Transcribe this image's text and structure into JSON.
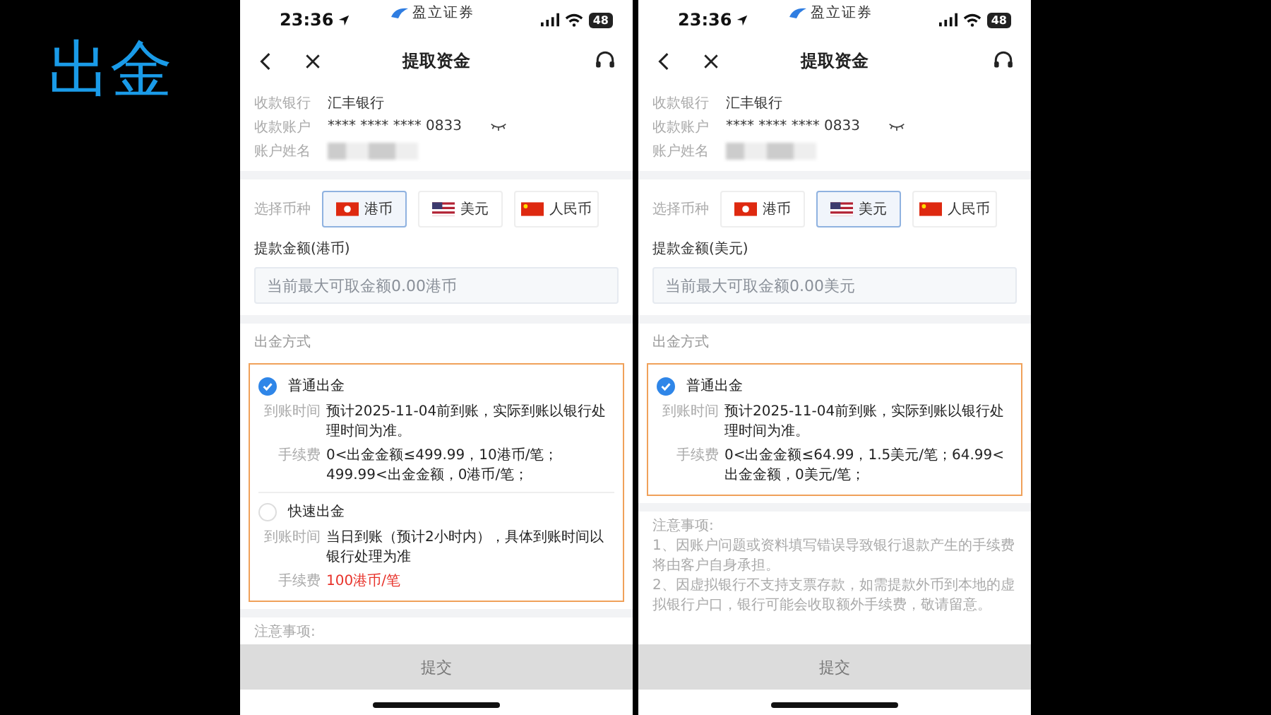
{
  "slide_title": "出金",
  "phones": [
    {
      "status": {
        "time": "23:36",
        "app_name": "盈立证券",
        "battery": "48"
      },
      "nav": {
        "title": "提取资金"
      },
      "account": {
        "rows": [
          {
            "kind": "text",
            "label": "收款银行",
            "value": "汇丰银行"
          },
          {
            "kind": "masked",
            "label": "收款账户",
            "value": "**** **** **** 0833"
          },
          {
            "kind": "blurred",
            "label": "账户姓名"
          }
        ]
      },
      "currency": {
        "label": "选择币种",
        "options": [
          {
            "kind": "hk",
            "label": "港币",
            "selected": true
          },
          {
            "kind": "us",
            "label": "美元",
            "selected": false
          },
          {
            "kind": "cn",
            "label": "人民币",
            "selected": false
          }
        ]
      },
      "amount": {
        "label": "提款金额(港币)",
        "placeholder": "当前最大可取金额0.00港币"
      },
      "methods": {
        "title": "出金方式",
        "items": [
          {
            "name": "普通出金",
            "selected": true,
            "rows": [
              {
                "label": "到账时间",
                "value": "预计2025-11-04前到账，实际到账以银行处理时间为准。",
                "alert": false
              },
              {
                "label": "手续费",
                "value": "0<出金金额≤499.99，10港币/笔；499.99<出金金额，0港币/笔；",
                "alert": false
              }
            ]
          },
          {
            "name": "快速出金",
            "selected": false,
            "rows": [
              {
                "label": "到账时间",
                "value": "当日到账（预计2小时内），具体到账时间以银行处理为准",
                "alert": false
              },
              {
                "label": "手续费",
                "value": "100港币/笔",
                "alert": true
              }
            ]
          }
        ]
      },
      "notes": {
        "title": "注意事项:"
      },
      "submit": "提交"
    },
    {
      "status": {
        "time": "23:36",
        "app_name": "盈立证券",
        "battery": "48"
      },
      "nav": {
        "title": "提取资金"
      },
      "account": {
        "rows": [
          {
            "kind": "text",
            "label": "收款银行",
            "value": "汇丰银行"
          },
          {
            "kind": "masked",
            "label": "收款账户",
            "value": "**** **** **** 0833"
          },
          {
            "kind": "blurred",
            "label": "账户姓名"
          }
        ]
      },
      "currency": {
        "label": "选择币种",
        "options": [
          {
            "kind": "hk",
            "label": "港币",
            "selected": false
          },
          {
            "kind": "us",
            "label": "美元",
            "selected": true
          },
          {
            "kind": "cn",
            "label": "人民币",
            "selected": false
          }
        ]
      },
      "amount": {
        "label": "提款金额(美元)",
        "placeholder": "当前最大可取金额0.00美元"
      },
      "methods": {
        "title": "出金方式",
        "items": [
          {
            "name": "普通出金",
            "selected": true,
            "rows": [
              {
                "label": "到账时间",
                "value": "预计2025-11-04前到账，实际到账以银行处理时间为准。",
                "alert": false
              },
              {
                "label": "手续费",
                "value": "0<出金金额≤64.99，1.5美元/笔；64.99<出金金额，0美元/笔；",
                "alert": false
              }
            ]
          }
        ]
      },
      "notes": {
        "title": "注意事项:",
        "lines": [
          "1、因账户问题或资料填写错误导致银行退款产生的手续费将由客户自身承担。",
          "2、因虚拟银行不支持支票存款，如需提款外币到本地的虚拟银行户口，银行可能会收取额外手续费，敬请留意。"
        ]
      },
      "submit": "提交"
    }
  ]
}
